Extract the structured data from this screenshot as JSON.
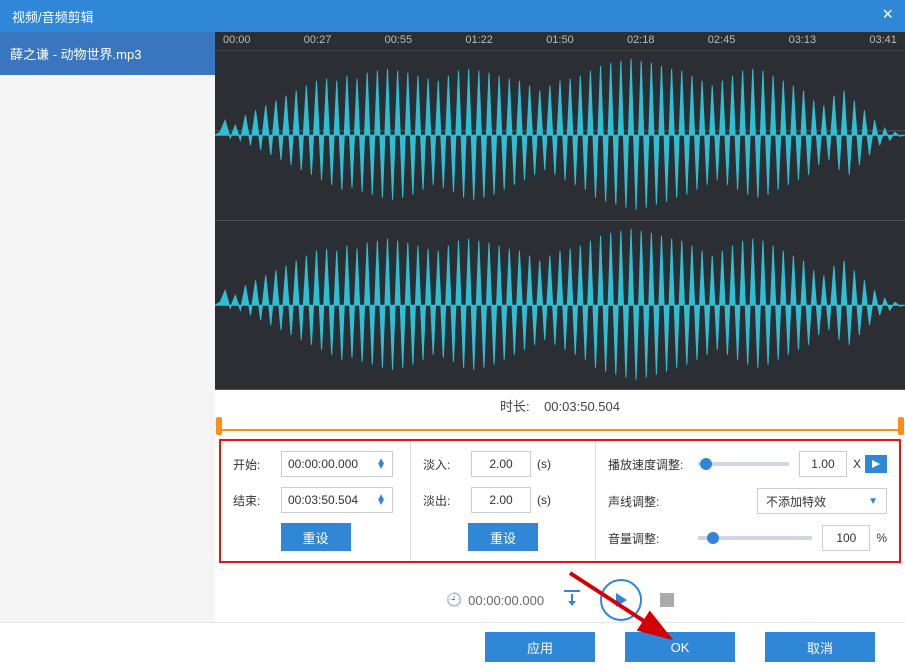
{
  "title": "视频/音频剪辑",
  "sidebar": {
    "file": "薛之谦 - 动物世界.mp3"
  },
  "ruler": [
    "00:00",
    "00:27",
    "00:55",
    "01:22",
    "01:50",
    "02:18",
    "02:45",
    "03:13",
    "03:41"
  ],
  "duration": {
    "label": "时长:",
    "value": "00:03:50.504"
  },
  "trim": {
    "start_label": "开始:",
    "start_value": "00:00:00.000",
    "end_label": "结束:",
    "end_value": "00:03:50.504",
    "reset": "重设"
  },
  "fade": {
    "in_label": "淡入:",
    "in_value": "2.00",
    "in_unit": "(s)",
    "out_label": "淡出:",
    "out_value": "2.00",
    "out_unit": "(s)",
    "reset": "重设"
  },
  "adjust": {
    "speed_label": "播放速度调整:",
    "speed_value": "1.00",
    "speed_unit": "X",
    "voice_label": "声线调整:",
    "voice_value": "不添加特效",
    "volume_label": "音量调整:",
    "volume_value": "100",
    "volume_unit": "%"
  },
  "playback": {
    "time": "00:00:00.000"
  },
  "footer": {
    "apply": "应用",
    "ok": "OK",
    "cancel": "取消"
  }
}
